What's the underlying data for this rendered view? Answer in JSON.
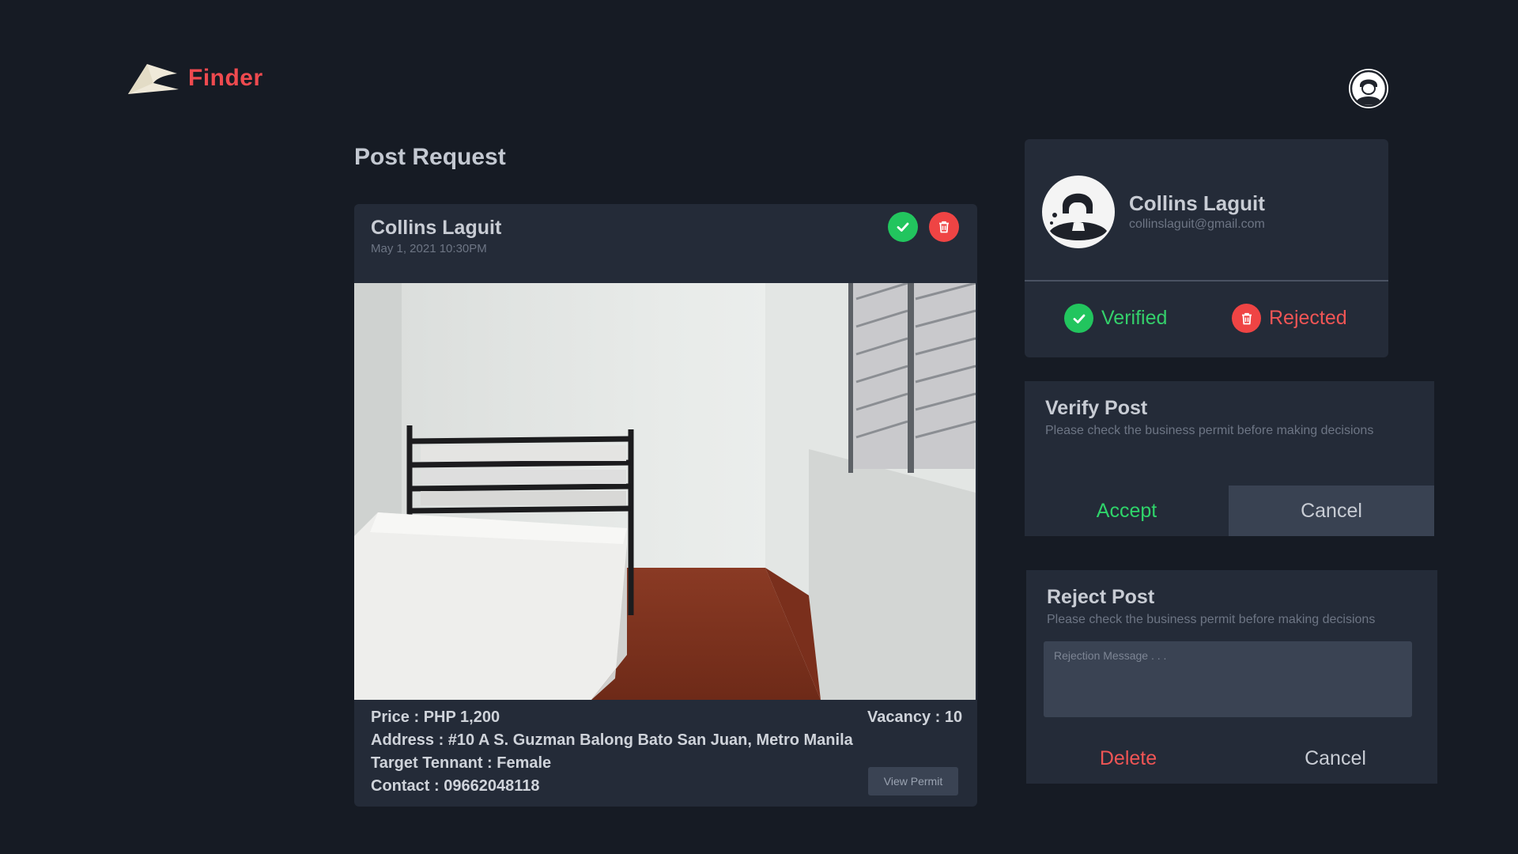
{
  "app": {
    "name": "Finder",
    "brand_color": "#ef4a4f"
  },
  "page": {
    "title": "Post Request"
  },
  "post": {
    "author": "Collins Laguit",
    "date": "May 1, 2021 10:30PM",
    "photo_alt": "room-photo",
    "price": "Price : PHP 1,200",
    "vacancy": "Vacancy : 10",
    "address": "Address : #10 A S. Guzman Balong Bato San Juan, Metro Manila",
    "target_tenant": "Target Tennant : Female",
    "contact": "Contact : 09662048118",
    "view_permit_label": "View Permit",
    "approve_icon": "check-icon",
    "delete_icon": "trash-icon"
  },
  "profile": {
    "name": "Collins Laguit",
    "email": "collinslaguit@gmail.com",
    "verified_label": "Verified",
    "rejected_label": "Rejected"
  },
  "verify_panel": {
    "title": "Verify Post",
    "subtitle": "Please check the business permit before making decisions",
    "accept_label": "Accept",
    "cancel_label": "Cancel"
  },
  "reject_panel": {
    "title": "Reject Post",
    "subtitle": "Please check the business permit before making decisions",
    "message_placeholder": "Rejection Message . . .",
    "message_value": "",
    "delete_label": "Delete",
    "cancel_label": "Cancel"
  },
  "colors": {
    "background": "#161b24",
    "card": "#242b38",
    "success": "#22c55e",
    "danger": "#ef4444"
  }
}
